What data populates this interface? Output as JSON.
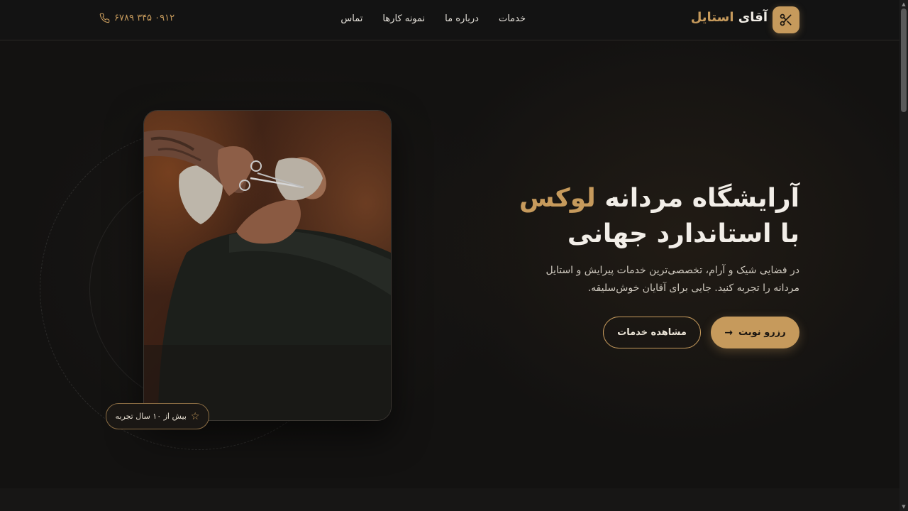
{
  "header": {
    "brand_part1": "آقای",
    "brand_part2": "استایل",
    "logo_icon": "scissors-icon",
    "nav": [
      "خدمات",
      "درباره ما",
      "نمونه کارها",
      "تماس"
    ],
    "phone_number": "۰۹۱۲ ۳۴۵ ۶۷۸۹",
    "phone_icon": "phone-icon"
  },
  "hero": {
    "title_line1_prefix": "آرایشگاه مردانه",
    "title_line1_accent": "لوکس",
    "title_line2": "با استاندارد جهانی",
    "description": "در فضایی شیک و آرام، تخصصی‌ترین خدمات پیرایش و استایل مردانه را تجربه کنید. جایی برای آقایان خوش‌سلیقه.",
    "primary_button": "رزرو نوبت",
    "secondary_button": "مشاهده خدمات",
    "badge_text": "بیش از ۱۰ سال تجربه"
  },
  "colors": {
    "accent": "#c69a5c",
    "background": "#131211"
  }
}
